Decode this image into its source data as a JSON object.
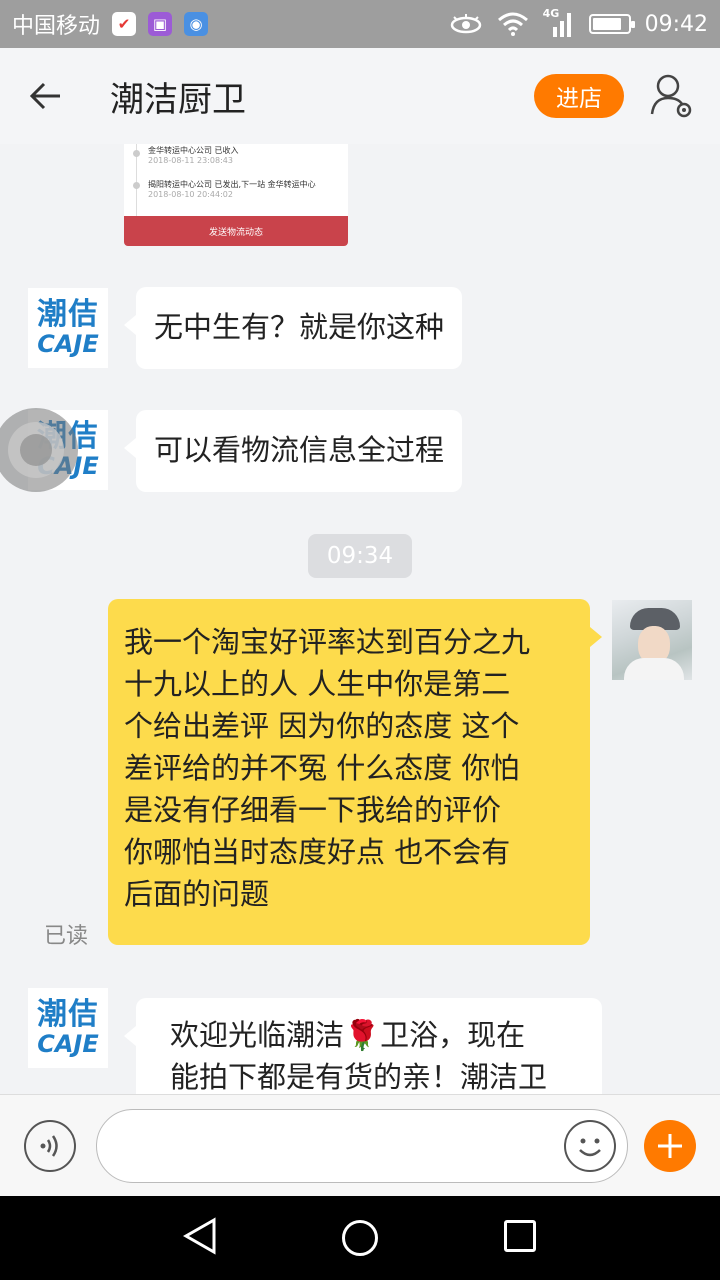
{
  "status_bar": {
    "carrier": "中国移动",
    "network": "4G",
    "time": "09:42",
    "battery_level": 0.85
  },
  "header": {
    "title": "潮洁厨卫",
    "enter_store_label": "进店"
  },
  "logistics_card": {
    "entries": [
      {
        "text": "金华转运中心公司 已收入",
        "time": "2018-08-11 23:08:43"
      },
      {
        "text": "揭阳转运中心公司 已发出,下一站 金华转运中心",
        "time": "2018-08-10 20:44:02"
      }
    ],
    "button_label": "发送物流动态"
  },
  "shop_avatar": {
    "cn": "潮佶",
    "en": "CAJE"
  },
  "messages": [
    {
      "from": "shop",
      "text": "无中生有？就是你这种"
    },
    {
      "from": "shop",
      "text": "可以看物流信息全过程"
    },
    {
      "type": "time",
      "text": "09:34"
    },
    {
      "from": "me",
      "lines": [
        "我一个淘宝好评率达到百分之九",
        "十九以上的人 人生中你是第二",
        "个给出差评 因为你的态度 这个",
        "差评给的并不冤 什么态度 你怕",
        "是没有仔细看一下我给的评价",
        "你哪怕当时态度好点 也不会有",
        "后面的问题"
      ],
      "read_status": "已读"
    },
    {
      "from": "shop",
      "lines": [
        "欢迎光临潮洁🌹卫浴，现在",
        "能拍下都是有货的亲！潮洁卫"
      ]
    }
  ],
  "input_bar": {
    "placeholder": ""
  },
  "icons": {
    "back": "back-arrow-icon",
    "user_settings": "user-settings-icon",
    "voice": "voice-icon",
    "emoji": "emoji-icon",
    "plus": "plus-icon"
  },
  "colors": {
    "accent": "#ff7a00",
    "my_bubble": "#fddb4c",
    "card_button": "#c9434b",
    "brand_blue": "#1f7ec7"
  }
}
